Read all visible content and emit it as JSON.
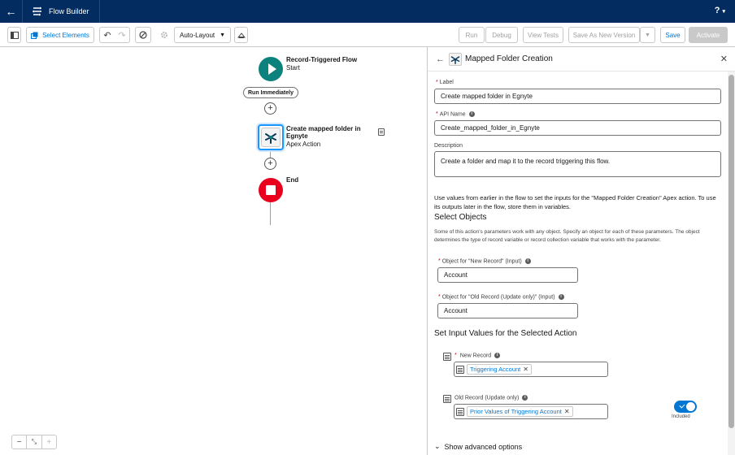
{
  "header": {
    "app_name": "Flow Builder",
    "help_label": "?"
  },
  "toolbar": {
    "select_elements": "Select Elements",
    "layout_mode": "Auto-Layout",
    "run": "Run",
    "debug": "Debug",
    "view_tests": "View Tests",
    "save_as_new_version": "Save As New Version",
    "save": "Save",
    "activate": "Activate"
  },
  "canvas": {
    "start": {
      "title": "Record-Triggered Flow",
      "subtitle": "Start"
    },
    "run_immediately": "Run Immediately",
    "action": {
      "title": "Create mapped folder in Egnyte",
      "subtitle": "Apex Action"
    },
    "end": {
      "title": "End"
    }
  },
  "panel": {
    "title": "Mapped Folder Creation",
    "label_field": {
      "label": "Label",
      "value": "Create mapped folder in Egnyte"
    },
    "api_name_field": {
      "label": "API Name",
      "value": "Create_mapped_folder_in_Egnyte"
    },
    "description_field": {
      "label": "Description",
      "value": "Create a folder and map it to the record triggering this flow."
    },
    "intro_text": "Use values from earlier in the flow to set the inputs for the \"Mapped Folder Creation\" Apex action. To use its outputs later in the flow, store them in variables.",
    "select_objects_heading": "Select Objects",
    "select_objects_text": "Some of this action's parameters work with any object. Specify an object for each of these parameters. The object determines the type of record variable or record collection variable that works with the parameter.",
    "object_new": {
      "label": "Object for \"New Record\" (Input)",
      "value": "Account"
    },
    "object_old": {
      "label": "Object for \"Old Record (Update only)\" (Input)",
      "value": "Account"
    },
    "input_values_heading": "Set Input Values for the Selected Action",
    "new_record": {
      "label": "New Record",
      "value": "Triggering Account"
    },
    "old_record": {
      "label": "Old Record (Update only)",
      "value": "Prior Values of Triggering Account",
      "toggle_label": "Included"
    },
    "advanced": "Show advanced options"
  }
}
